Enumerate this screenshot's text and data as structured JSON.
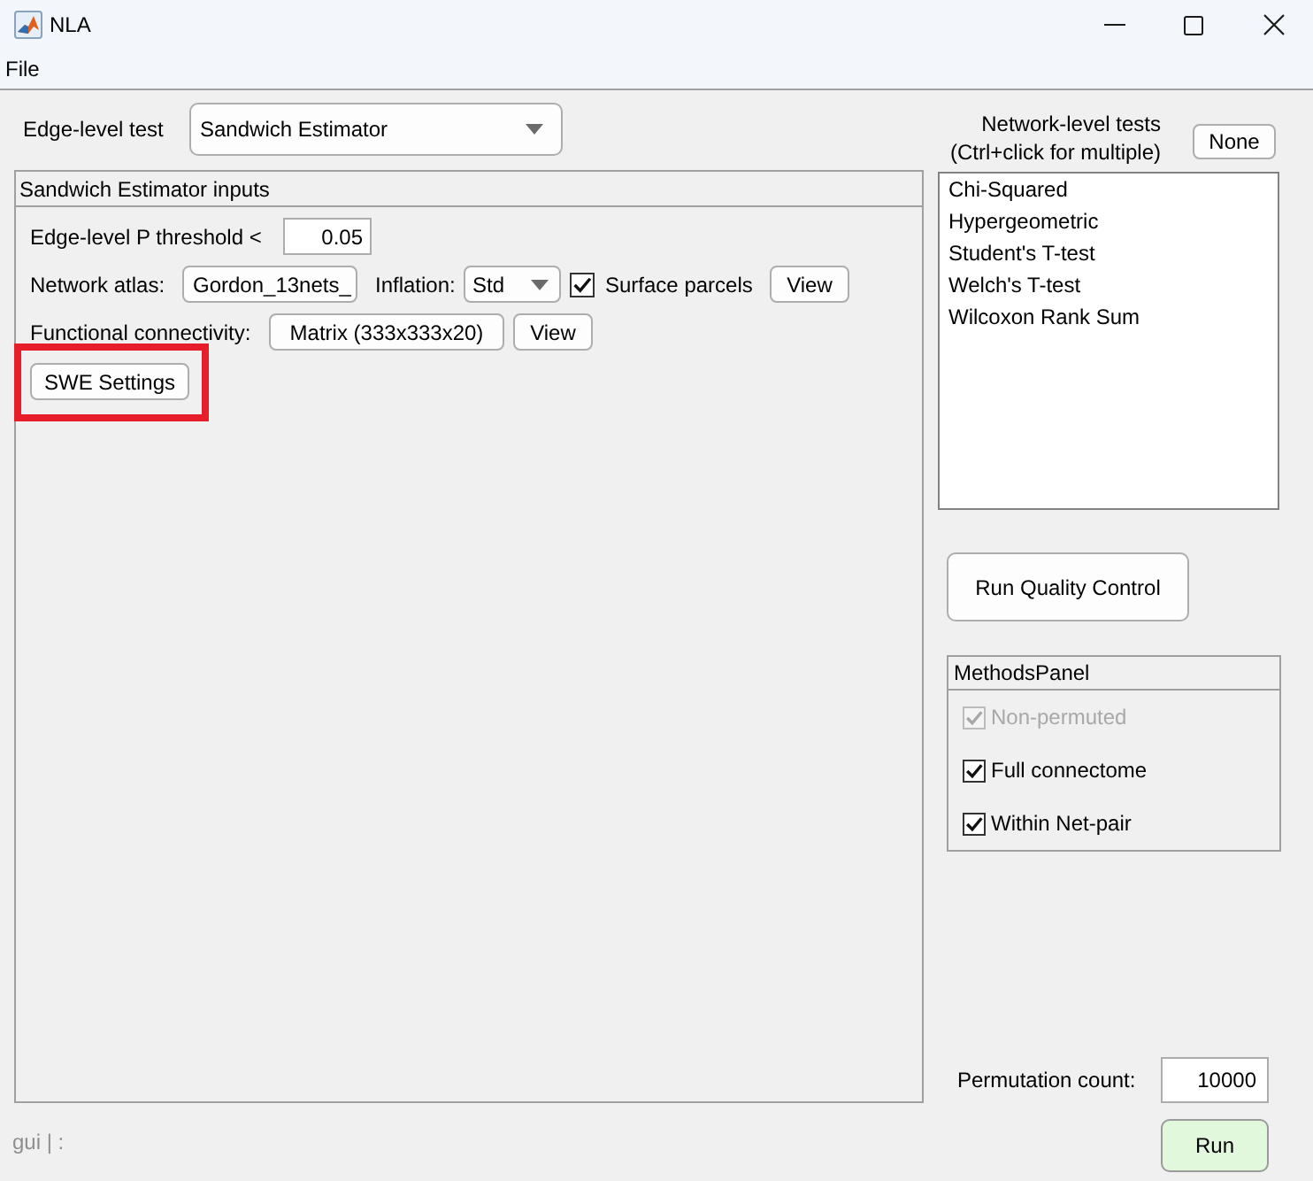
{
  "window": {
    "title": "NLA"
  },
  "menu": [
    {
      "label": "File"
    }
  ],
  "edge_level_test": {
    "label": "Edge-level test",
    "value": "Sandwich Estimator"
  },
  "inputs_panel": {
    "title": "Sandwich Estimator inputs",
    "p_threshold": {
      "label": "Edge-level P threshold <",
      "value": "0.05"
    },
    "network_atlas": {
      "label": "Network atlas:",
      "value": "Gordon_13nets_"
    },
    "inflation": {
      "label": "Inflation:",
      "value": "Std"
    },
    "surface_parcels": {
      "label": "Surface parcels",
      "checked": true
    },
    "atlas_view_button": {
      "label": "View"
    },
    "functional_connectivity": {
      "label": "Functional connectivity:",
      "value": "Matrix (333x333x20)"
    },
    "connectivity_view_button": {
      "label": "View"
    },
    "swe_settings_button": {
      "label": "SWE Settings",
      "highlighted": true
    }
  },
  "network_level_tests": {
    "title": "Network-level tests",
    "hint": "(Ctrl+click for multiple)",
    "none_button": {
      "label": "None"
    },
    "items": [
      {
        "label": "Chi-Squared",
        "selected": false
      },
      {
        "label": "Hypergeometric",
        "selected": false
      },
      {
        "label": "Student's T-test",
        "selected": false
      },
      {
        "label": "Welch's T-test",
        "selected": false
      },
      {
        "label": "Wilcoxon Rank Sum",
        "selected": false
      }
    ]
  },
  "quality_control_button": {
    "label": "Run Quality Control"
  },
  "methods_panel": {
    "title": "MethodsPanel",
    "options": [
      {
        "label": "Non-permuted",
        "checked": true,
        "disabled": true
      },
      {
        "label": "Full connectome",
        "checked": true,
        "disabled": false
      },
      {
        "label": "Within Net-pair",
        "checked": true,
        "disabled": false
      }
    ]
  },
  "permutation_count": {
    "label": "Permutation count:",
    "value": "10000"
  },
  "run_button": {
    "label": "Run"
  },
  "status_bar": {
    "text": "gui | :"
  }
}
